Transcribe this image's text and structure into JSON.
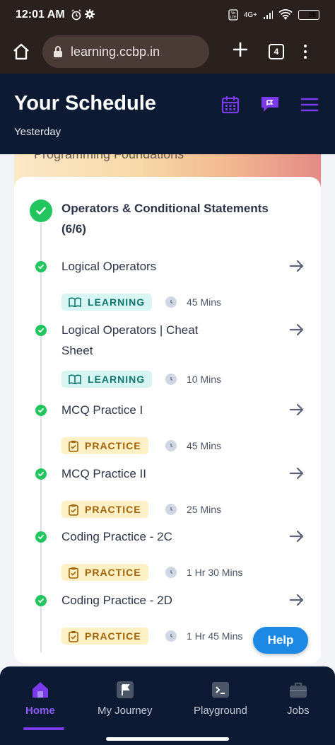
{
  "status": {
    "time": "12:01 AM",
    "network": "4G+",
    "battery": "35",
    "battery_level": 0.35
  },
  "browser": {
    "url": "learning.ccbp.in",
    "tab_count": "4"
  },
  "header": {
    "title": "Your Schedule",
    "subtitle": "Yesterday"
  },
  "previous_card": {
    "title": "Programming Foundations"
  },
  "module": {
    "title": "Operators & Conditional Statements (6/6)"
  },
  "items": [
    {
      "title": "Logical Operators",
      "tag": "LEARNING",
      "duration": "45 Mins"
    },
    {
      "title": "Logical Operators | Cheat Sheet",
      "tag": "LEARNING",
      "duration": "10 Mins"
    },
    {
      "title": "MCQ Practice I",
      "tag": "PRACTICE",
      "duration": "45 Mins"
    },
    {
      "title": "MCQ Practice II",
      "tag": "PRACTICE",
      "duration": "25 Mins"
    },
    {
      "title": "Coding Practice - 2C",
      "tag": "PRACTICE",
      "duration": "1 Hr 30 Mins"
    },
    {
      "title": "Coding Practice - 2D",
      "tag": "PRACTICE",
      "duration": "1 Hr 45 Mins"
    }
  ],
  "help": {
    "label": "Help"
  },
  "nav": [
    {
      "label": "Home",
      "active": true
    },
    {
      "label": "My Journey",
      "active": false
    },
    {
      "label": "Playground",
      "active": false
    },
    {
      "label": "Jobs",
      "active": false
    }
  ],
  "colors": {
    "header_bg": "#0c1a33",
    "accent": "#7c3aed",
    "success": "#22c55e",
    "learning_bg": "#d6f5f3",
    "practice_bg": "#fdf0c4",
    "help": "#1e88e5"
  }
}
